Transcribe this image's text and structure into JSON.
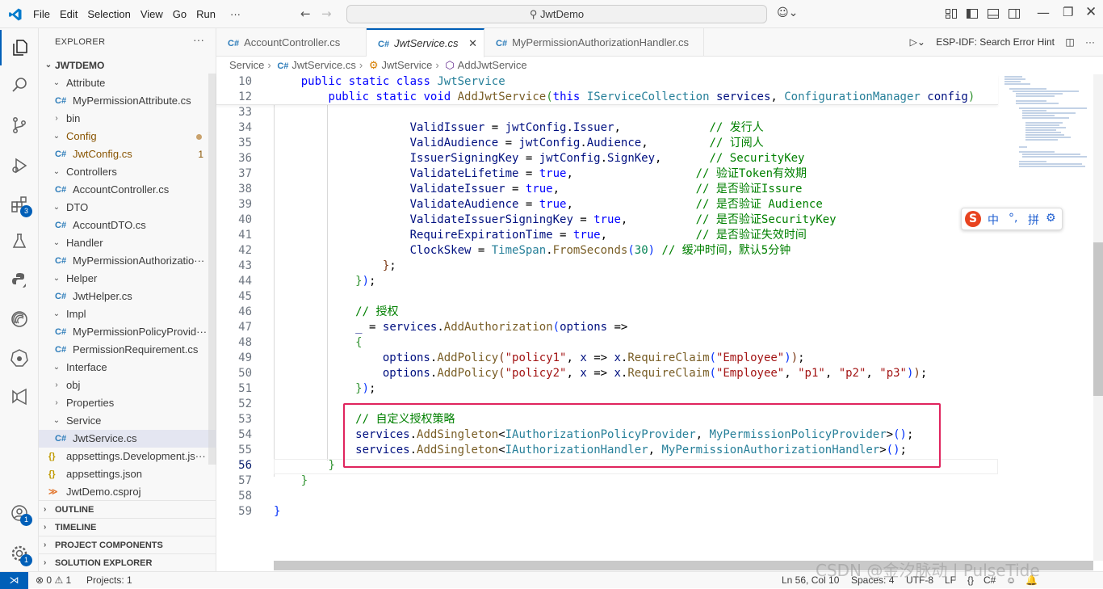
{
  "menu": [
    "File",
    "Edit",
    "Selection",
    "View",
    "Go",
    "Run",
    "···"
  ],
  "search": {
    "text": "JwtDemo"
  },
  "explorer": {
    "title": "EXPLORER",
    "root": "JWTDEMO",
    "items": [
      {
        "label": "Attribute",
        "type": "folder-open",
        "depth": 1
      },
      {
        "label": "MyPermissionAttribute.cs",
        "type": "cs",
        "depth": 2
      },
      {
        "label": "bin",
        "type": "folder-closed",
        "depth": 1
      },
      {
        "label": "Config",
        "type": "folder-open",
        "depth": 1,
        "modified": true
      },
      {
        "label": "JwtConfig.cs",
        "type": "cs",
        "depth": 2,
        "modified": true,
        "count": "1"
      },
      {
        "label": "Controllers",
        "type": "folder-open",
        "depth": 1
      },
      {
        "label": "AccountController.cs",
        "type": "cs",
        "depth": 2
      },
      {
        "label": "DTO",
        "type": "folder-open",
        "depth": 1
      },
      {
        "label": "AccountDTO.cs",
        "type": "cs",
        "depth": 2
      },
      {
        "label": "Handler",
        "type": "folder-open",
        "depth": 1
      },
      {
        "label": "MyPermissionAuthorizatio···",
        "type": "cs",
        "depth": 2
      },
      {
        "label": "Helper",
        "type": "folder-open",
        "depth": 1
      },
      {
        "label": "JwtHelper.cs",
        "type": "cs",
        "depth": 2
      },
      {
        "label": "Impl",
        "type": "folder-open",
        "depth": 1
      },
      {
        "label": "MyPermissionPolicyProvid···",
        "type": "cs",
        "depth": 2
      },
      {
        "label": "PermissionRequirement.cs",
        "type": "cs",
        "depth": 2
      },
      {
        "label": "Interface",
        "type": "folder-open",
        "depth": 1
      },
      {
        "label": "obj",
        "type": "folder-closed",
        "depth": 1
      },
      {
        "label": "Properties",
        "type": "folder-closed",
        "depth": 1
      },
      {
        "label": "Service",
        "type": "folder-open",
        "depth": 1
      },
      {
        "label": "JwtService.cs",
        "type": "cs",
        "depth": 2,
        "selected": true
      },
      {
        "label": "appsettings.Development.js···",
        "type": "json",
        "depth": 1
      },
      {
        "label": "appsettings.json",
        "type": "json",
        "depth": 1
      },
      {
        "label": "JwtDemo.csproj",
        "type": "rss",
        "depth": 1
      }
    ],
    "sections": [
      "OUTLINE",
      "TIMELINE",
      "PROJECT COMPONENTS",
      "SOLUTION EXPLORER"
    ]
  },
  "tabs": [
    {
      "label": "AccountController.cs",
      "active": false
    },
    {
      "label": "JwtService.cs",
      "active": true
    },
    {
      "label": "MyPermissionAuthorizationHandler.cs",
      "active": false
    }
  ],
  "tab_actions": {
    "hint": "ESP-IDF: Search Error Hint"
  },
  "breadcrumb": [
    "Service",
    "JwtService.cs",
    "JwtService",
    "AddJwtService"
  ],
  "editor": {
    "sticky": [
      {
        "num": "10",
        "html": "    <span class=\"kw\">public</span> <span class=\"kw\">static</span> <span class=\"kw\">class</span> <span class=\"ty\">JwtService</span>"
      },
      {
        "num": "12",
        "html": "        <span class=\"kw\">public</span> <span class=\"kw\">static</span> <span class=\"kw\">void</span> <span class=\"fn\">AddJwtService</span><span class=\"br2\">(</span><span class=\"kw\">this</span> <span class=\"ty\">IServiceCollection</span> <span class=\"pr\">services</span>, <span class=\"ty\">ConfigurationManager</span> <span class=\"pr\">config</span><span class=\"br2\">)</span>"
      }
    ],
    "lines": [
      {
        "num": "33",
        "html": ""
      },
      {
        "num": "34",
        "html": "                    <span class=\"pr\">ValidIssuer</span> = <span class=\"pr\">jwtConfig</span>.<span class=\"pr\">Issuer</span>,             <span class=\"cm\">// 发行人</span>"
      },
      {
        "num": "35",
        "html": "                    <span class=\"pr\">ValidAudience</span> = <span class=\"pr\">jwtConfig</span>.<span class=\"pr\">Audience</span>,         <span class=\"cm\">// 订阅人</span>"
      },
      {
        "num": "36",
        "html": "                    <span class=\"pr\">IssuerSigningKey</span> = <span class=\"pr\">jwtConfig</span>.<span class=\"pr\">SignKey</span>,       <span class=\"cm\">// SecurityKey</span>"
      },
      {
        "num": "37",
        "html": "                    <span class=\"pr\">ValidateLifetime</span> = <span class=\"kw\">true</span>,                  <span class=\"cm\">// 验证Token有效期</span>"
      },
      {
        "num": "38",
        "html": "                    <span class=\"pr\">ValidateIssuer</span> = <span class=\"kw\">true</span>,                    <span class=\"cm\">// 是否验证Issure</span>"
      },
      {
        "num": "39",
        "html": "                    <span class=\"pr\">ValidateAudience</span> = <span class=\"kw\">true</span>,                  <span class=\"cm\">// 是否验证 Audience</span>"
      },
      {
        "num": "40",
        "html": "                    <span class=\"pr\">ValidateIssuerSigningKey</span> = <span class=\"kw\">true</span>,          <span class=\"cm\">// 是否验证SecurityKey</span>"
      },
      {
        "num": "41",
        "html": "                    <span class=\"pr\">RequireExpirationTime</span> = <span class=\"kw\">true</span>,             <span class=\"cm\">// 是否验证失效时间</span>"
      },
      {
        "num": "42",
        "html": "                    <span class=\"pr\">ClockSkew</span> = <span class=\"ty\">TimeSpan</span>.<span class=\"fn\">FromSeconds</span><span class=\"br1\">(</span><span class=\"nm\">30</span><span class=\"br1\">)</span> <span class=\"cm\">// 缓冲时间，默认5分钟</span>"
      },
      {
        "num": "43",
        "html": "                <span class=\"br3\">}</span>;"
      },
      {
        "num": "44",
        "html": "            <span class=\"br2\">}</span><span class=\"br1\">)</span>;"
      },
      {
        "num": "45",
        "html": ""
      },
      {
        "num": "46",
        "html": "            <span class=\"cm\">// 授权</span>"
      },
      {
        "num": "47",
        "html": "            <span class=\"pr\">_</span> = <span class=\"pr\">services</span>.<span class=\"fn\">AddAuthorization</span><span class=\"br1\">(</span><span class=\"pr\">options</span> =>"
      },
      {
        "num": "48",
        "html": "            <span class=\"br2\">{</span>"
      },
      {
        "num": "49",
        "html": "                <span class=\"pr\">options</span>.<span class=\"fn\">AddPolicy</span><span class=\"br3\">(</span><span class=\"st\">\"policy1\"</span>, <span class=\"pr\">x</span> => <span class=\"pr\">x</span>.<span class=\"fn\">RequireClaim</span><span class=\"br1\">(</span><span class=\"st\">\"Employee\"</span><span class=\"br1\">)</span><span class=\"br3\">)</span>;"
      },
      {
        "num": "50",
        "html": "                <span class=\"pr\">options</span>.<span class=\"fn\">AddPolicy</span><span class=\"br3\">(</span><span class=\"st\">\"policy2\"</span>, <span class=\"pr\">x</span> => <span class=\"pr\">x</span>.<span class=\"fn\">RequireClaim</span><span class=\"br1\">(</span><span class=\"st\">\"Employee\"</span>, <span class=\"st\">\"p1\"</span>, <span class=\"st\">\"p2\"</span>, <span class=\"st\">\"p3\"</span><span class=\"br1\">)</span><span class=\"br3\">)</span>;"
      },
      {
        "num": "51",
        "html": "            <span class=\"br2\">}</span><span class=\"br1\">)</span>;"
      },
      {
        "num": "52",
        "html": ""
      },
      {
        "num": "53",
        "html": "            <span class=\"cm\">// 自定义授权策略</span>"
      },
      {
        "num": "54",
        "html": "            <span class=\"pr\">services</span>.<span class=\"fn\">AddSingleton</span>&lt;<span class=\"ty\">IAuthorizationPolicyProvider</span>, <span class=\"ty\">MyPermissionPolicyProvider</span>&gt;<span class=\"br1\">()</span>;"
      },
      {
        "num": "55",
        "html": "            <span class=\"pr\">services</span>.<span class=\"fn\">AddSingleton</span>&lt;<span class=\"ty\">IAuthorizationHandler</span>, <span class=\"ty\">MyPermissionAuthorizationHandler</span>&gt;<span class=\"br1\">()</span>;"
      },
      {
        "num": "56",
        "html": "        <span class=\"br2\">}</span>",
        "current": true
      },
      {
        "num": "57",
        "html": "    <span class=\"br2\">}</span>"
      },
      {
        "num": "58",
        "html": ""
      },
      {
        "num": "59",
        "html": "<span class=\"br1\">}</span>"
      }
    ]
  },
  "ime": {
    "lang": "中",
    "punct": "°,",
    "mode": "拼"
  },
  "statusbar": {
    "errors": "0",
    "warnings": "1",
    "projects": "Projects: 1",
    "position": "Ln 56, Col 10",
    "spaces": "Spaces: 4",
    "encoding": "UTF-8",
    "eol": "LF",
    "language": "C#"
  },
  "watermark": "CSDN @金汐脉动 | PulseTide",
  "badges": {
    "extensions": "3",
    "accounts": "1",
    "manage": "1"
  },
  "colors": {
    "accent": "#005fb8",
    "highlight_box": "#e0245e"
  }
}
